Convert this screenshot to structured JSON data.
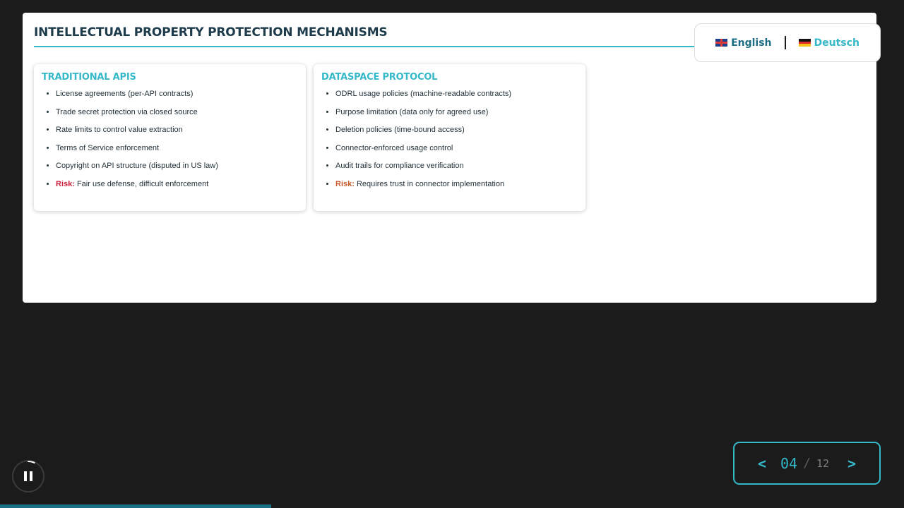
{
  "slide": {
    "title": "INTELLECTUAL PROPERTY PROTECTION MECHANISMS",
    "cards": [
      {
        "title": "TRADITIONAL APIS",
        "items": [
          "License agreements (per-API contracts)",
          "Trade secret protection via closed source",
          "Rate limits to control value extraction",
          "Terms of Service enforcement",
          "Copyright on API structure (disputed in US law)"
        ],
        "risk_label": "Risk:",
        "risk_text": " Fair use defense, difficult enforcement"
      },
      {
        "title": "DATASPACE PROTOCOL",
        "items": [
          "ODRL usage policies (machine-readable contracts)",
          "Purpose limitation (data only for agreed use)",
          "Deletion policies (time-bound access)",
          "Connector-enforced usage control",
          "Audit trails for compliance verification"
        ],
        "risk_label": "Risk:",
        "risk_text": " Requires trust in connector implementation"
      }
    ]
  },
  "language": {
    "english": "English",
    "deutsch": "Deutsch",
    "english_icon": "uk-flag-icon",
    "deutsch_icon": "german-flag-icon"
  },
  "pager": {
    "prev": "<",
    "current": "04",
    "separator": "/",
    "total": "12",
    "next": ">"
  },
  "playback": {
    "icon": "pause-icon",
    "progress": 0.3
  },
  "colors": {
    "accent": "#35b8c8",
    "dark_accent": "#1d6f86",
    "risk_red": "#c8203a",
    "risk_orange": "#c45a2a"
  }
}
